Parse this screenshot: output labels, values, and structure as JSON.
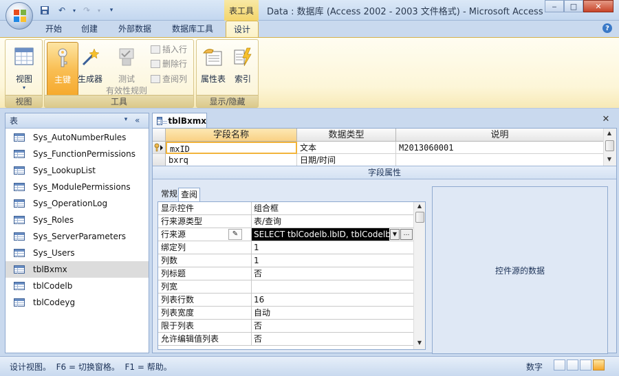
{
  "titlebar": {
    "context_tab": "表工具",
    "title": "Data : 数据库 (Access 2002 - 2003 文件格式) - Microsoft Access",
    "buttons": {
      "minimize": "‒",
      "maximize": "□",
      "close": "✕"
    }
  },
  "ribbon_tabs": [
    "开始",
    "创建",
    "外部数据",
    "数据库工具",
    "设计"
  ],
  "ribbon": {
    "groups": {
      "views": {
        "label": "视图",
        "view_btn": "视图"
      },
      "tools": {
        "label": "工具",
        "primary_key": "主键",
        "builder": "生成器",
        "test_rules_1": "测试",
        "test_rules_2": "有效性规则",
        "insert_row": "插入行",
        "delete_row": "删除行",
        "lookup_col": "查阅列"
      },
      "show_hide": {
        "label": "显示/隐藏",
        "property_sheet": "属性表",
        "indexes": "索引"
      }
    }
  },
  "nav": {
    "header": "表",
    "items": [
      "Sys_AutoNumberRules",
      "Sys_FunctionPermissions",
      "Sys_LookupList",
      "Sys_ModulePermissions",
      "Sys_OperationLog",
      "Sys_Roles",
      "Sys_ServerParameters",
      "Sys_Users",
      "tblBxmx",
      "tblCodelb",
      "tblCodeyg"
    ],
    "selected_index": 8
  },
  "document": {
    "tab_title": "tblBxmx",
    "columns": [
      "字段名称",
      "数据类型",
      "说明"
    ],
    "rows": [
      {
        "name": "mxID",
        "type": "文本",
        "desc": "M2013060001",
        "is_key": true
      },
      {
        "name": "bxrq",
        "type": "日期/时间",
        "desc": "",
        "is_key": false
      }
    ],
    "field_props_label": "字段属性",
    "prop_tabs": [
      "常规",
      "查阅"
    ],
    "active_prop_tab": 1,
    "properties": [
      {
        "name": "显示控件",
        "value": "组合框"
      },
      {
        "name": "行来源类型",
        "value": "表/查询"
      },
      {
        "name": "行来源",
        "value": "SELECT tblCodelb.lbID, tblCodelb."
      },
      {
        "name": "绑定列",
        "value": "1"
      },
      {
        "name": "列数",
        "value": "1"
      },
      {
        "name": "列标题",
        "value": "否"
      },
      {
        "name": "列宽",
        "value": ""
      },
      {
        "name": "列表行数",
        "value": "16"
      },
      {
        "name": "列表宽度",
        "value": "自动"
      },
      {
        "name": "限于列表",
        "value": "否"
      },
      {
        "name": "允许编辑值列表",
        "value": "否"
      }
    ],
    "help_text": "控件源的数据"
  },
  "statusbar": {
    "left": "设计视图。  F6 = 切换窗格。  F1 = 帮助。",
    "right": "数字"
  }
}
